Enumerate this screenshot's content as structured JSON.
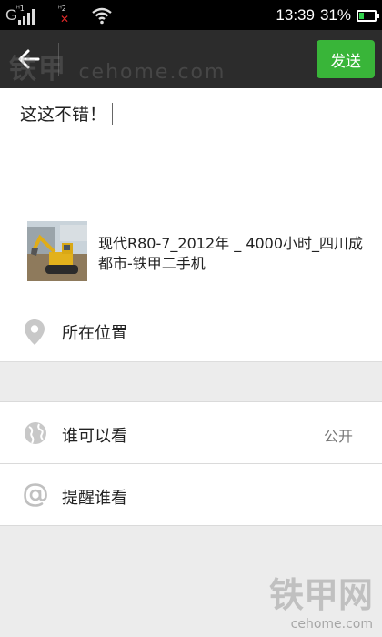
{
  "status_bar": {
    "sim1_type": "G",
    "sim1_tag": "ᴴ1",
    "sim2_tag": "ᴴ2",
    "time": "13:39",
    "battery_percent": "31%",
    "battery_level": 0.31,
    "icons": [
      "signal-icon",
      "no-signal-icon",
      "wifi-icon",
      "battery-icon"
    ]
  },
  "header": {
    "back_icon": "back-arrow-icon",
    "send_label": "发送",
    "accent_color": "#39b539"
  },
  "compose": {
    "text": "这这不错！"
  },
  "link_card": {
    "title": "现代R80-7_2012年 _ 4000小时_四川成都市-铁甲二手机",
    "thumbnail": "excavator-photo"
  },
  "location": {
    "icon": "location-pin-icon",
    "label": "所在位置"
  },
  "visibility": {
    "icon": "globe-icon",
    "label": "谁可以看",
    "value": "公开"
  },
  "remind": {
    "icon": "at-icon",
    "label": "提醒谁看"
  },
  "watermark": {
    "top_cn": "铁甲",
    "top_domain": "cehome.com",
    "bottom_cn": "铁甲网",
    "bottom_domain": "cehome.com"
  }
}
